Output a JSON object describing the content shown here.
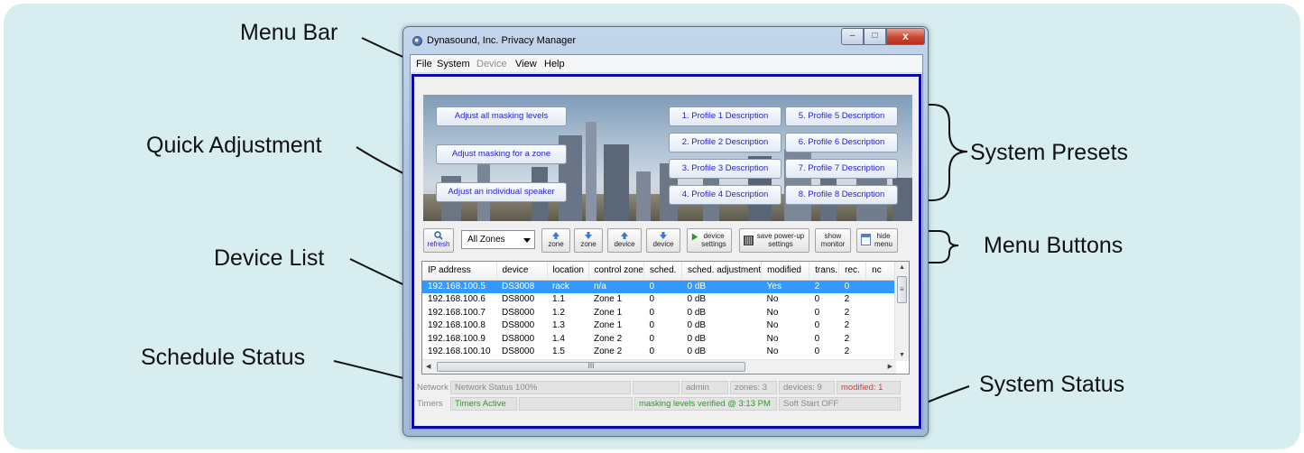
{
  "callouts": {
    "menu_bar": "Menu Bar",
    "quick_adjustment": "Quick Adjustment",
    "device_list": "Device List",
    "schedule_status": "Schedule Status",
    "system_presets": "System Presets",
    "menu_buttons": "Menu Buttons",
    "system_status": "System Status"
  },
  "window": {
    "title": "Dynasound, Inc. Privacy Manager",
    "controls": {
      "minimize": "–",
      "maximize": "□",
      "close": "x"
    }
  },
  "menu": {
    "items": [
      {
        "label": "File",
        "enabled": true
      },
      {
        "label": "System",
        "enabled": true
      },
      {
        "label": "Device",
        "enabled": false
      },
      {
        "label": "View",
        "enabled": true
      },
      {
        "label": "Help",
        "enabled": true
      }
    ]
  },
  "quick": {
    "all": "Adjust all masking levels",
    "zone": "Adjust masking for a zone",
    "speaker": "Adjust an individual speaker"
  },
  "presets": [
    "1. Profile 1 Description",
    "2. Profile 2 Description",
    "3. Profile 3 Description",
    "4. Profile 4 Description",
    "5. Profile 5 Description",
    "6. Profile 6 Description",
    "7. Profile 7 Description",
    "8. Profile 8 Description"
  ],
  "toolbar": {
    "refresh": "refresh",
    "zones_select": "All Zones",
    "zone_up": "zone",
    "zone_down": "zone",
    "device_up": "device",
    "device_down": "device",
    "device_settings": [
      "device",
      "settings"
    ],
    "save_power_up": [
      "save power-up",
      "settings"
    ],
    "show_monitor": [
      "show",
      "monitor"
    ],
    "hide_menu": [
      "hide",
      "menu"
    ]
  },
  "device_list": {
    "columns": [
      "IP address",
      "device",
      "location",
      "control zone",
      "sched.",
      "sched. adjustment",
      "modified",
      "trans.",
      "rec.",
      "nc"
    ],
    "rows": [
      [
        "192.168.100.5",
        "DS3008",
        "rack",
        "n/a",
        "0",
        "0 dB",
        "Yes",
        "2",
        "0",
        ""
      ],
      [
        "192.168.100.6",
        "DS8000",
        "1.1",
        "Zone 1",
        "0",
        "0 dB",
        "No",
        "0",
        "2",
        ""
      ],
      [
        "192.168.100.7",
        "DS8000",
        "1.2",
        "Zone 1",
        "0",
        "0 dB",
        "No",
        "0",
        "2",
        ""
      ],
      [
        "192.168.100.8",
        "DS8000",
        "1.3",
        "Zone 1",
        "0",
        "0 dB",
        "No",
        "0",
        "2",
        ""
      ],
      [
        "192.168.100.9",
        "DS8000",
        "1.4",
        "Zone 2",
        "0",
        "0 dB",
        "No",
        "0",
        "2",
        ""
      ],
      [
        "192.168.100.10",
        "DS8000",
        "1.5",
        "Zone 2",
        "0",
        "0 dB",
        "No",
        "0",
        "2",
        ""
      ]
    ],
    "selected_row": 0,
    "scroll_marker": "III",
    "vscroll_marker": "≡"
  },
  "status": {
    "network_label": "Network",
    "network_status": "Network Status 100%",
    "user": "admin",
    "zones": "zones: 3",
    "devices": "devices: 9",
    "modified": "modified: 1",
    "timers_label": "Timers",
    "timers_status": "Timers Active",
    "verified": "masking levels verified @ 3:13 PM",
    "soft_start": "Soft Start OFF"
  },
  "colors": {
    "backdrop": "#d7edf0",
    "frame_blue": "#0a0aa8",
    "preset_text": "#2222d0",
    "selection": "#3399ff",
    "timers_green": "#2a9a2a",
    "modified_red": "#d23c3c"
  }
}
